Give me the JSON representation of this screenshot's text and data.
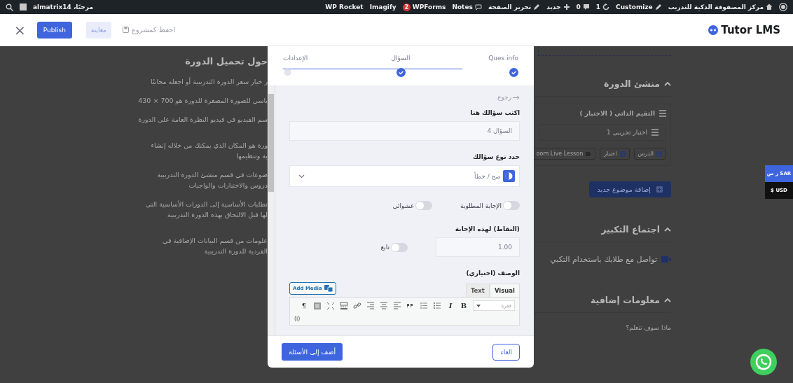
{
  "admin_bar": {
    "greeting": "مرحبًا، almatrix14",
    "items": [
      {
        "kind": "wp"
      },
      {
        "kind": "site",
        "label": "مركز المصفوفة الذكية للتدريب"
      },
      {
        "kind": "customize",
        "label": "Customize"
      },
      {
        "kind": "updates",
        "label": "1"
      },
      {
        "kind": "comments",
        "label": "0"
      },
      {
        "kind": "new",
        "label": "جديد"
      },
      {
        "kind": "edit",
        "label": "تحرير الصفحة"
      },
      {
        "kind": "notes",
        "label": "Notes"
      },
      {
        "kind": "badge",
        "label": "WPForms",
        "badge": "2"
      },
      {
        "kind": "plain",
        "label": "Imagify"
      },
      {
        "kind": "plain",
        "label": "WP Rocket"
      }
    ]
  },
  "header": {
    "close": "×",
    "publish": "Publish",
    "preview": "معاينة",
    "save_draft": "احفظ كمشروع",
    "logo": "Tutor LMS"
  },
  "background_page": {
    "tips_heading": "حول تحميل الدورة",
    "tips": [
      [
        "ر خيار سعر الدورة التدريبية أو اجعله مجانيًا"
      ],
      [
        "ياسي للصورة المصغرة للدورة هو 700 × 430"
      ],
      [
        "سم الفيديو في فيديو النظرة العامة على الدورة"
      ],
      [
        "ورة هو المكان الذي يمكنك من خلاله إنشاء",
        "ية وتنظيمها"
      ],
      [
        "ضوعات في قسم منشئ الدورة التدريبية",
        "دروس والاختبارات والواجبات"
      ],
      [
        "تطلبات الأساسية إلى الدورات الأساسية التي",
        "لها قبل الالتحاق بهذه الدورة التدريبية"
      ],
      [
        "علومات من قسم البيانات الإضافية في",
        "الفردية للدورة التدريبية"
      ]
    ],
    "builder_heading": "منشئ الدورة",
    "topic_title": "التقيم الذاتي ( الاختبار )",
    "quiz_item": "اختبار تجريبي 1",
    "content_buttons": [
      {
        "kind": "lesson",
        "label": "الدرس"
      },
      {
        "kind": "quiz",
        "label": "اختبار"
      },
      {
        "kind": "zoom",
        "label": "oom Live Lesson"
      }
    ],
    "add_topic": "إضافة موضوع جديد",
    "zoom_heading": "اجتماع التكبير",
    "zoom_text": "تواصل مع طلابك باستخدام التكبي",
    "extra_heading": "معلومات إضافية",
    "learn_label": "ماذا سوف تتعلم؟"
  },
  "modal": {
    "steps": [
      {
        "label": "Ques info",
        "done": true
      },
      {
        "label": "السؤال",
        "done": true
      },
      {
        "label": "الإعدادات",
        "done": false
      }
    ],
    "back": "رجوع",
    "question_label": "اكتب سؤالك هنا",
    "question_value": "السؤال 4",
    "type_label": "حدد نوع سؤالك",
    "type_value": "صح / خطأ",
    "toggles": [
      {
        "label": "الإجابة المطلوبة",
        "on": false
      },
      {
        "label": "عشوائي",
        "on": false
      }
    ],
    "points_label": "(النقاط) لهذه الإجابة",
    "points_value": "1.00",
    "points_toggle": {
      "label": "تابع",
      "on": false
    },
    "description_label": "الوصف (اختياري)",
    "add_media": "Add Media",
    "editor_tabs": [
      {
        "label": "Visual",
        "selected": true
      },
      {
        "label": "Text",
        "selected": false
      }
    ],
    "format": "فقرة",
    "toolbar": [
      {
        "kind": "bold",
        "label": "B"
      },
      {
        "kind": "italic",
        "label": "I"
      },
      {
        "kind": "ul"
      },
      {
        "kind": "ol"
      },
      {
        "kind": "quote"
      },
      {
        "kind": "align-left"
      },
      {
        "kind": "align-center"
      },
      {
        "kind": "align-right"
      },
      {
        "kind": "link"
      },
      {
        "kind": "more"
      },
      {
        "kind": "fullscreen"
      },
      {
        "kind": "toggle"
      },
      {
        "kind": "pilcrow",
        "label": "¶"
      }
    ],
    "toolbar_row2": "(i)",
    "cancel": "الغاء",
    "submit": "أضف إلى الأسئلة"
  },
  "currency": [
    {
      "label": "ر س SAR",
      "selected": true
    },
    {
      "label": "$ USD",
      "selected": false
    }
  ]
}
